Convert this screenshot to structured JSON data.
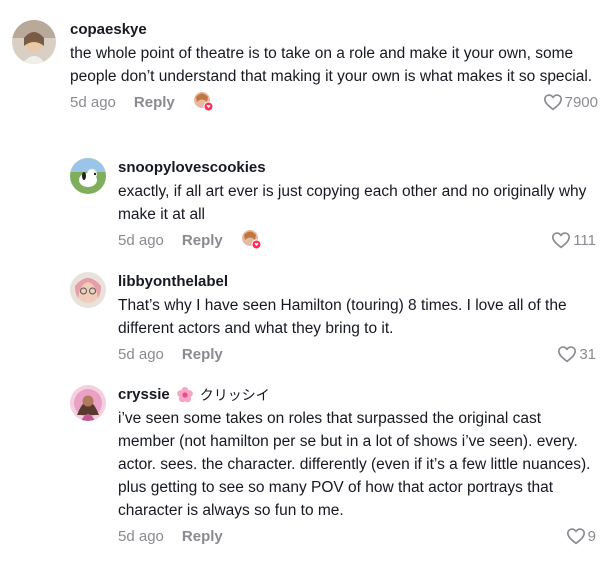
{
  "comments": [
    {
      "username": "copaeskye",
      "text": "the whole point of theatre is to take on a role and make it your own, some people don’t understand that making it your own is what makes it so special.",
      "age": "5d ago",
      "reply_label": "Reply",
      "likes": "7900",
      "liked_by_creator": true
    },
    {
      "username": "snoopylovescookies",
      "text": "exactly, if all art ever is just copying each other and no originally why make it at all",
      "age": "5d ago",
      "reply_label": "Reply",
      "likes": "111",
      "liked_by_creator": true
    },
    {
      "username": "libbyonthelabel",
      "text": "That’s why I have seen Hamilton (touring) 8 times. I love all of the different actors and what they bring to it.",
      "age": "5d ago",
      "reply_label": "Reply",
      "likes": "31",
      "liked_by_creator": false
    },
    {
      "username": "cryssie",
      "username_suffix": "クリッシイ",
      "text": "i’ve seen some takes on roles that surpassed the original cast member (not hamilton per se but in a lot of shows i’ve seen). every. actor. sees. the character. differently (even if it’s a few little nuances). plus getting to see so many POV of how that actor portrays that character is always so fun to me.",
      "age": "5d ago",
      "reply_label": "Reply",
      "likes": "9",
      "liked_by_creator": false
    }
  ],
  "colors": {
    "text": "#161823",
    "muted": "#8a8b91",
    "creator_badge": "#fe2c55"
  },
  "icons": {
    "like": "heart-outline-icon",
    "flower": "flower-icon"
  }
}
